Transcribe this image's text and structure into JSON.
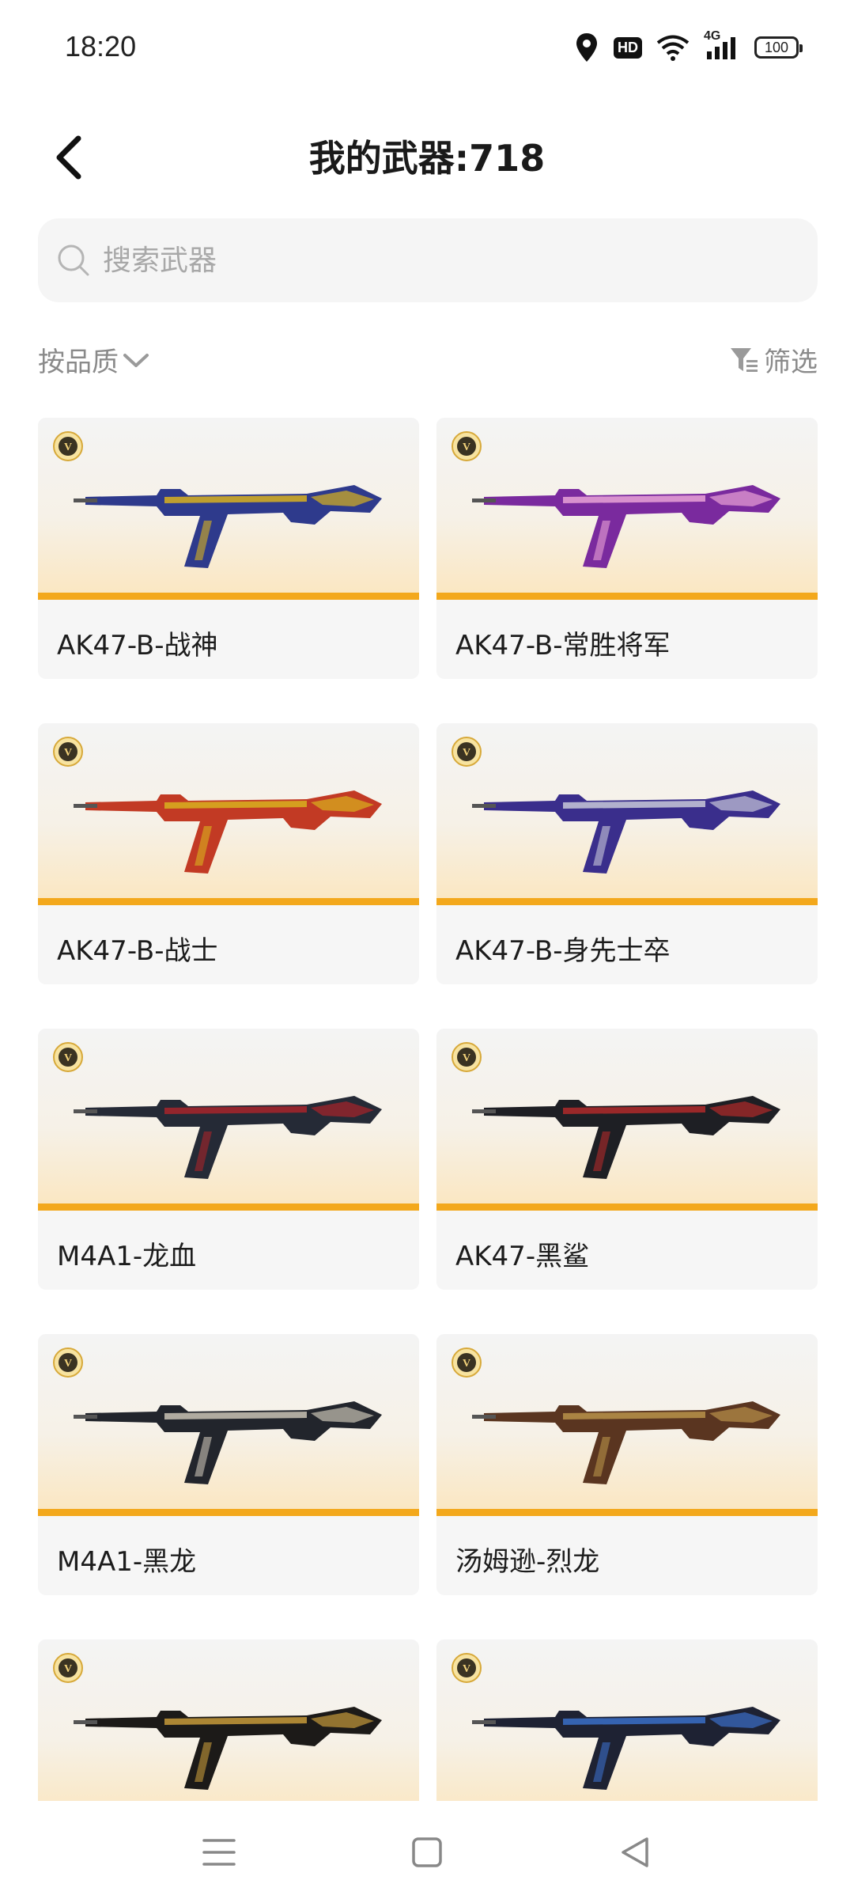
{
  "status": {
    "time": "18:20",
    "hd": "HD",
    "network": "4G",
    "battery": "100"
  },
  "header": {
    "title": "我的武器:718"
  },
  "search": {
    "placeholder": "搜索武器"
  },
  "filters": {
    "sort_label": "按品质",
    "filter_label": "筛选"
  },
  "colors": {
    "accent": "#f3a81c",
    "placeholder": "#a8a8a8",
    "muted": "#8a8a8a"
  },
  "weapons": [
    {
      "name": "AK47-B-战神",
      "palette": [
        "#2e3a8c",
        "#d8b21e"
      ]
    },
    {
      "name": "AK47-B-常胜将军",
      "palette": [
        "#7a2a9e",
        "#e9a3d6"
      ]
    },
    {
      "name": "AK47-B-战士",
      "palette": [
        "#c23a24",
        "#d8b21e"
      ]
    },
    {
      "name": "AK47-B-身先士卒",
      "palette": [
        "#3a2e8c",
        "#c8c8d8"
      ]
    },
    {
      "name": "M4A1-龙血",
      "palette": [
        "#252a36",
        "#a8242a"
      ]
    },
    {
      "name": "AK47-黑鲨",
      "palette": [
        "#1e1f24",
        "#b02a2a"
      ]
    },
    {
      "name": "M4A1-黑龙",
      "palette": [
        "#22252c",
        "#c9c3b5"
      ]
    },
    {
      "name": "汤姆逊-烈龙",
      "palette": [
        "#5a3520",
        "#b8924a"
      ]
    },
    {
      "name": "",
      "palette": [
        "#1c1a18",
        "#c59a3a"
      ]
    },
    {
      "name": "",
      "palette": [
        "#1e2233",
        "#3a6ec8"
      ]
    }
  ]
}
